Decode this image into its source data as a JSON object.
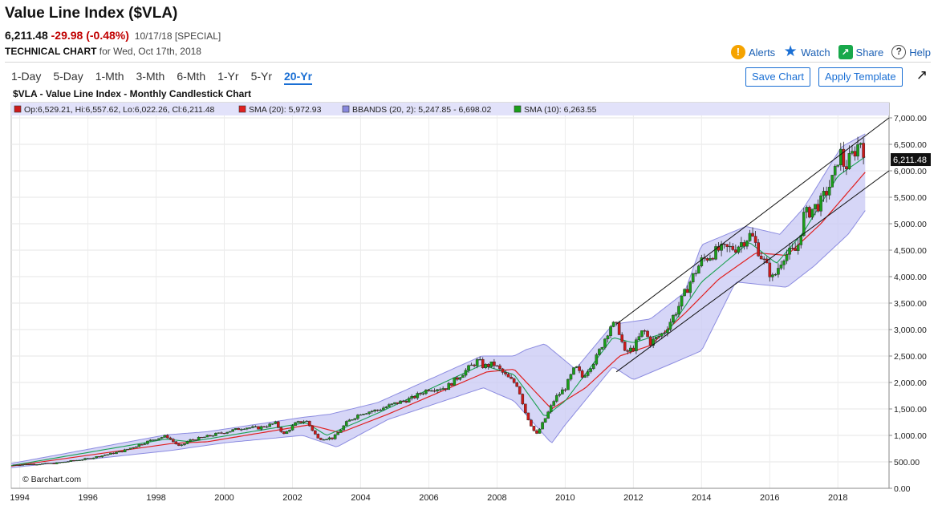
{
  "header": {
    "title": "Value Line Index ($VLA)",
    "last": "6,211.48",
    "change": "-29.98 (-0.48%)",
    "meta": "10/17/18 [SPECIAL]",
    "tech_label": "TECHNICAL CHART",
    "tech_date": "for Wed, Oct 17th, 2018"
  },
  "actions": {
    "alerts": "Alerts",
    "watch": "Watch",
    "share": "Share",
    "help": "Help"
  },
  "tabs": [
    "1-Day",
    "5-Day",
    "1-Mth",
    "3-Mth",
    "6-Mth",
    "1-Yr",
    "5-Yr",
    "20-Yr"
  ],
  "active_tab": "20-Yr",
  "buttons": {
    "save": "Save Chart",
    "apply": "Apply Template"
  },
  "legend": {
    "ohlc": "Op:6,529.21, Hi:6,557.62, Lo:6,022.26, Cl:6,211.48",
    "sma20": "SMA (20): 5,972.93",
    "bbands": "BBANDS (20, 2): 5,247.85 - 6,698.02",
    "sma10": "SMA (10): 6,263.55"
  },
  "colors": {
    "up": "#1a9e1a",
    "down": "#cc1a1a",
    "sma20": "#e02020",
    "sma10": "#1aa050",
    "band_fill": "#c8c8f4",
    "band_line": "#8c8ce0",
    "link": "#1a6fd4",
    "legend_bg": "#e2e2fa"
  },
  "chart_data": {
    "type": "candlestick",
    "title": "$VLA - Value Line Index - Monthly Candlestick Chart",
    "price_label": "6,211.48",
    "credit": "© Barchart.com",
    "x_ticks": [
      "1994",
      "1996",
      "1998",
      "2000",
      "2002",
      "2004",
      "2006",
      "2008",
      "2010",
      "2012",
      "2014",
      "2016",
      "2018"
    ],
    "y_ticks": [
      "0.00",
      "500.00",
      "1,000.00",
      "1,500.00",
      "2,000.00",
      "2,500.00",
      "3,000.00",
      "3,500.00",
      "4,000.00",
      "4,500.00",
      "5,000.00",
      "5,500.00",
      "6,000.00",
      "6,500.00",
      "7,000.00"
    ],
    "xlim": [
      1993.75,
      2019.5
    ],
    "ylim": [
      0,
      7000
    ],
    "close_path": [
      [
        1993.75,
        440
      ],
      [
        1995.0,
        470
      ],
      [
        1996.0,
        560
      ],
      [
        1997.0,
        700
      ],
      [
        1997.9,
        920
      ],
      [
        1998.3,
        990
      ],
      [
        1998.7,
        780
      ],
      [
        1998.95,
        900
      ],
      [
        1999.5,
        980
      ],
      [
        2000.0,
        1060
      ],
      [
        2000.6,
        1150
      ],
      [
        2001.0,
        1140
      ],
      [
        2001.5,
        1230
      ],
      [
        2001.75,
        1020
      ],
      [
        2002.1,
        1230
      ],
      [
        2002.4,
        1280
      ],
      [
        2002.75,
        940
      ],
      [
        2003.2,
        950
      ],
      [
        2003.6,
        1250
      ],
      [
        2004.0,
        1420
      ],
      [
        2004.5,
        1480
      ],
      [
        2005.0,
        1600
      ],
      [
        2005.5,
        1700
      ],
      [
        2006.0,
        1880
      ],
      [
        2006.5,
        1900
      ],
      [
        2007.0,
        2180
      ],
      [
        2007.45,
        2420
      ],
      [
        2007.6,
        2300
      ],
      [
        2007.9,
        2350
      ],
      [
        2008.3,
        2100
      ],
      [
        2008.6,
        1950
      ],
      [
        2008.85,
        1400
      ],
      [
        2009.15,
        1000
      ],
      [
        2009.4,
        1300
      ],
      [
        2009.7,
        1700
      ],
      [
        2010.0,
        1900
      ],
      [
        2010.3,
        2300
      ],
      [
        2010.5,
        2100
      ],
      [
        2010.9,
        2450
      ],
      [
        2011.35,
        3100
      ],
      [
        2011.55,
        3050
      ],
      [
        2011.75,
        2550
      ],
      [
        2012.0,
        2650
      ],
      [
        2012.3,
        3000
      ],
      [
        2012.5,
        2750
      ],
      [
        2012.9,
        2950
      ],
      [
        2013.3,
        3400
      ],
      [
        2013.7,
        3950
      ],
      [
        2014.0,
        4300
      ],
      [
        2014.5,
        4500
      ],
      [
        2015.0,
        4550
      ],
      [
        2015.45,
        4800
      ],
      [
        2015.7,
        4450
      ],
      [
        2016.1,
        3950
      ],
      [
        2016.4,
        4400
      ],
      [
        2016.8,
        4500
      ],
      [
        2017.0,
        5150
      ],
      [
        2017.5,
        5400
      ],
      [
        2017.9,
        5900
      ],
      [
        2018.05,
        6400
      ],
      [
        2018.2,
        6050
      ],
      [
        2018.6,
        6500
      ],
      [
        2018.7,
        6600
      ],
      [
        2018.8,
        6211.48
      ]
    ],
    "sma10": [
      [
        1993.75,
        430
      ],
      [
        1998.3,
        930
      ],
      [
        1999.0,
        880
      ],
      [
        2002.4,
        1240
      ],
      [
        2003.0,
        1000
      ],
      [
        2004.5,
        1420
      ],
      [
        2007.55,
        2330
      ],
      [
        2008.5,
        2150
      ],
      [
        2009.4,
        1350
      ],
      [
        2010.0,
        1650
      ],
      [
        2011.4,
        2850
      ],
      [
        2012.0,
        2750
      ],
      [
        2013.0,
        2950
      ],
      [
        2014.0,
        3900
      ],
      [
        2015.4,
        4650
      ],
      [
        2016.2,
        4250
      ],
      [
        2017.0,
        4850
      ],
      [
        2018.0,
        5900
      ],
      [
        2018.8,
        6263.55
      ]
    ],
    "sma20": [
      [
        1993.75,
        420
      ],
      [
        1998.5,
        850
      ],
      [
        1999.5,
        880
      ],
      [
        2002.5,
        1200
      ],
      [
        2003.4,
        1050
      ],
      [
        2004.8,
        1400
      ],
      [
        2007.7,
        2200
      ],
      [
        2008.5,
        2250
      ],
      [
        2009.6,
        1500
      ],
      [
        2010.6,
        1900
      ],
      [
        2011.6,
        2500
      ],
      [
        2012.5,
        2700
      ],
      [
        2013.5,
        3300
      ],
      [
        2014.5,
        3950
      ],
      [
        2015.6,
        4450
      ],
      [
        2016.5,
        4400
      ],
      [
        2017.5,
        5000
      ],
      [
        2018.8,
        5972.93
      ]
    ],
    "bb_upper": [
      [
        1993.75,
        470
      ],
      [
        1998.3,
        1010
      ],
      [
        1999.5,
        1070
      ],
      [
        2002.3,
        1340
      ],
      [
        2003.1,
        1400
      ],
      [
        2004.5,
        1620
      ],
      [
        2007.55,
        2500
      ],
      [
        2008.5,
        2500
      ],
      [
        2008.85,
        2620
      ],
      [
        2009.4,
        2730
      ],
      [
        2010.3,
        2250
      ],
      [
        2011.4,
        3100
      ],
      [
        2012.5,
        3200
      ],
      [
        2013.5,
        3700
      ],
      [
        2014.0,
        4600
      ],
      [
        2015.3,
        4950
      ],
      [
        2016.3,
        4800
      ],
      [
        2017.0,
        5300
      ],
      [
        2018.1,
        6450
      ],
      [
        2018.8,
        6698.02
      ]
    ],
    "bb_lower": [
      [
        1993.75,
        390
      ],
      [
        1998.5,
        720
      ],
      [
        2000.0,
        860
      ],
      [
        2002.3,
        1000
      ],
      [
        2003.3,
        780
      ],
      [
        2004.8,
        1300
      ],
      [
        2007.6,
        1900
      ],
      [
        2008.5,
        1650
      ],
      [
        2009.6,
        850
      ],
      [
        2010.0,
        1200
      ],
      [
        2011.4,
        2300
      ],
      [
        2012.0,
        2050
      ],
      [
        2013.1,
        2350
      ],
      [
        2014.0,
        2600
      ],
      [
        2015.0,
        3900
      ],
      [
        2016.5,
        3800
      ],
      [
        2017.3,
        4200
      ],
      [
        2018.3,
        4800
      ],
      [
        2018.8,
        5247.85
      ]
    ],
    "trend_upper": [
      [
        2011.5,
        3100
      ],
      [
        2019.5,
        7000
      ]
    ],
    "trend_lower": [
      [
        2011.5,
        2200
      ],
      [
        2019.5,
        6000
      ]
    ]
  }
}
